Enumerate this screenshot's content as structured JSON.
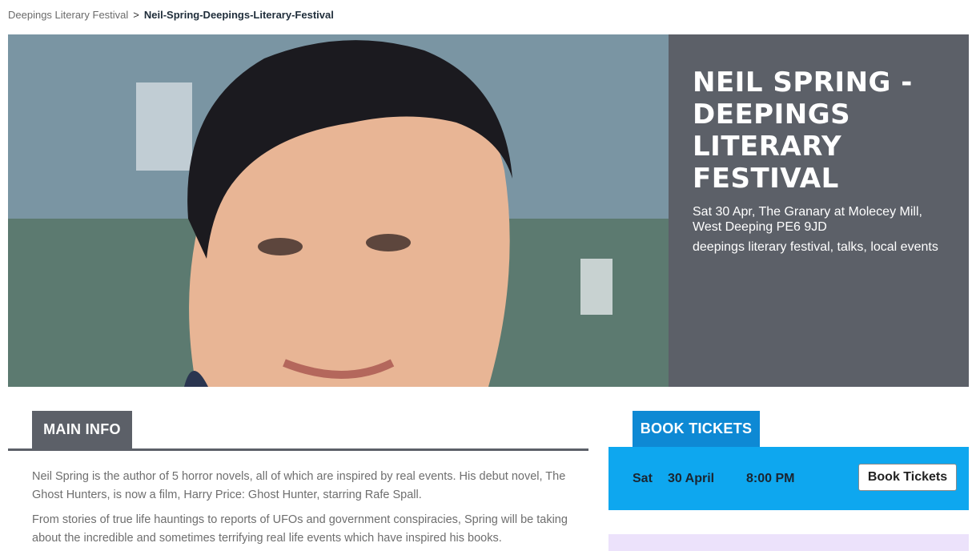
{
  "breadcrumb": {
    "parent": "Deepings Literary Festival",
    "separator": ">",
    "current": "Neil-Spring-Deepings-Literary-Festival"
  },
  "hero": {
    "image_icon": "author-portrait-photo",
    "title": "NEIL SPRING - DEEPINGS LITERARY FESTIVAL",
    "date_location": "Sat 30 Apr, The Granary at Molecey Mill, West Deeping PE6 9JD",
    "tags": "deepings literary festival, talks, local events"
  },
  "main_info": {
    "tab_label": "MAIN INFO",
    "paragraphs": [
      " Neil Spring is the author of 5 horror novels, all of which are inspired by real events. His debut novel, The Ghost Hunters, is now a film, Harry Price: Ghost Hunter, starring Rafe Spall.",
      "From stories of true life hauntings to reports of UFOs and government conspiracies, Spring will be taking about the incredible and sometimes terrifying real life events which have inspired his books."
    ]
  },
  "tickets": {
    "tab_label": "BOOK TICKETS",
    "day": "Sat",
    "date": "30 April",
    "time": "8:00 PM",
    "button_label": "Book Tickets"
  },
  "colors": {
    "panel_grey": "#5c6068",
    "ticket_tab_blue": "#0e89d4",
    "ticket_row_blue": "#0ea7ef",
    "lilac": "#ece2fb"
  }
}
